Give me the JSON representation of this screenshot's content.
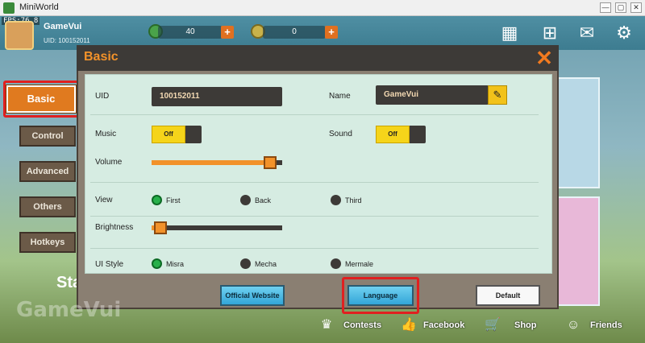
{
  "window": {
    "title": "MiniWorld",
    "fps": "FPS:76.8",
    "controls": [
      "—",
      "▢",
      "✕"
    ]
  },
  "player": {
    "name": "GameVui",
    "uid_line": "UID: 100152011"
  },
  "currency": {
    "gems": "40",
    "coins": "0",
    "plus": "+"
  },
  "tabs": [
    "Basic",
    "Control",
    "Advanced",
    "Others",
    "Hotkeys"
  ],
  "dialog": {
    "title": "Basic",
    "close": "✕",
    "uid_label": "UID",
    "uid_value": "100152011",
    "name_label": "Name",
    "name_value": "GameVui",
    "edit_icon": "✎",
    "music_label": "Music",
    "music_state": "Off",
    "sound_label": "Sound",
    "sound_state": "Off",
    "volume_label": "Volume",
    "volume_level": 0.95,
    "view_label": "View",
    "view_options": [
      "First",
      "Back",
      "Third"
    ],
    "view_selected": "First",
    "brightness_label": "Brightness",
    "brightness_level": 0.02,
    "ui_style_label": "UI Style",
    "ui_style_options": [
      "Misra",
      "Mecha",
      "Mermale"
    ],
    "ui_style_selected": "Misra",
    "buttons": {
      "official_website": "Official Website",
      "language": "Language",
      "default": "Default"
    }
  },
  "bottom_nav": [
    "Contests",
    "Facebook",
    "Shop",
    "Friends"
  ],
  "watermark": "GameVui",
  "partial_text": "Sta",
  "colors": {
    "accent_orange": "#f2922a",
    "toggle_yellow": "#f5d41a",
    "radio_green": "#27b04a",
    "highlight_red": "#e02020",
    "panel_mint": "#d6ece2"
  }
}
